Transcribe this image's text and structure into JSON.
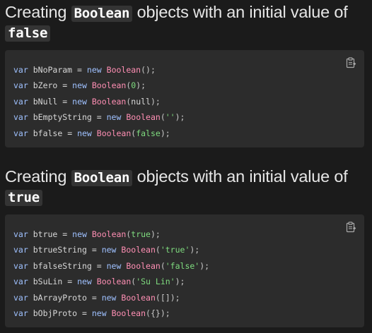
{
  "sections": [
    {
      "heading": {
        "prefix": "Creating ",
        "code": "Boolean",
        "suffix": " objects with an initial value of",
        "line2_code": "false"
      },
      "code_lines": [
        {
          "kw": "var",
          "name": "bNoParam",
          "eq": "=",
          "new": "new",
          "ctor": "Boolean",
          "open": "(",
          "arg": "",
          "arg_type": "none",
          "close": ");"
        },
        {
          "kw": "var",
          "name": "bZero",
          "eq": "=",
          "new": "new",
          "ctor": "Boolean",
          "open": "(",
          "arg": "0",
          "arg_type": "num",
          "close": ");"
        },
        {
          "kw": "var",
          "name": "bNull",
          "eq": "=",
          "new": "new",
          "ctor": "Boolean",
          "open": "(",
          "arg": "null",
          "arg_type": "id",
          "close": ");"
        },
        {
          "kw": "var",
          "name": "bEmptyString",
          "eq": "=",
          "new": "new",
          "ctor": "Boolean",
          "open": "(",
          "arg": "''",
          "arg_type": "str",
          "close": ");"
        },
        {
          "kw": "var",
          "name": "bfalse",
          "eq": "=",
          "new": "new",
          "ctor": "Boolean",
          "open": "(",
          "arg": "false",
          "arg_type": "lit",
          "close": ");"
        }
      ]
    },
    {
      "heading": {
        "prefix": "Creating ",
        "code": "Boolean",
        "suffix": " objects with an initial value of",
        "line2_code": "true"
      },
      "code_lines": [
        {
          "kw": "var",
          "name": "btrue",
          "eq": "=",
          "new": "new",
          "ctor": "Boolean",
          "open": "(",
          "arg": "true",
          "arg_type": "lit",
          "close": ");"
        },
        {
          "kw": "var",
          "name": "btrueString",
          "eq": "=",
          "new": "new",
          "ctor": "Boolean",
          "open": "(",
          "arg": "'true'",
          "arg_type": "str",
          "close": ");"
        },
        {
          "kw": "var",
          "name": "bfalseString",
          "eq": "=",
          "new": "new",
          "ctor": "Boolean",
          "open": "(",
          "arg": "'false'",
          "arg_type": "str",
          "close": ");"
        },
        {
          "kw": "var",
          "name": "bSuLin",
          "eq": "=",
          "new": "new",
          "ctor": "Boolean",
          "open": "(",
          "arg": "'Su Lin'",
          "arg_type": "str",
          "close": ");"
        },
        {
          "kw": "var",
          "name": "bArrayProto",
          "eq": "=",
          "new": "new",
          "ctor": "Boolean",
          "open": "(",
          "arg": "[]",
          "arg_type": "pn",
          "close": ");"
        },
        {
          "kw": "var",
          "name": "bObjProto",
          "eq": "=",
          "new": "new",
          "ctor": "Boolean",
          "open": "(",
          "arg": "{}",
          "arg_type": "pn",
          "close": ");"
        }
      ]
    }
  ],
  "icons": {
    "copy": "clipboard-icon"
  },
  "colors": {
    "background": "#1b1b1b",
    "code_block": "#2c2c2c",
    "keyword": "#9fc1ff",
    "constructor": "#ff8fb4",
    "literal": "#7fdc7f"
  }
}
